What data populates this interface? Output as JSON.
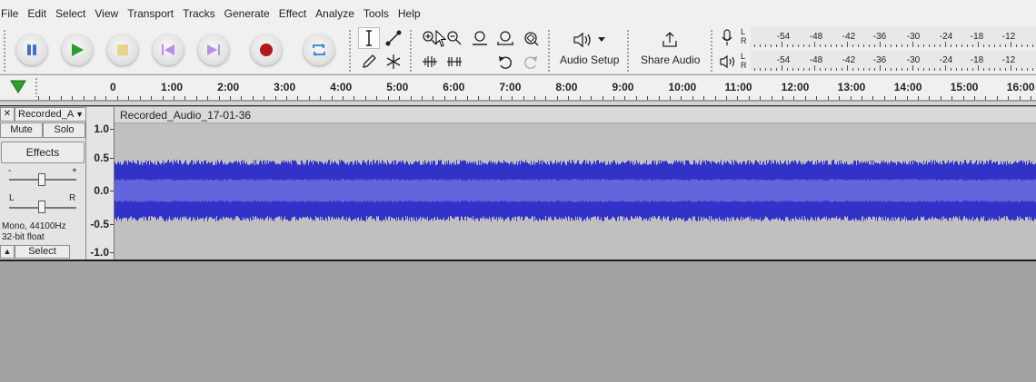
{
  "menu": [
    "File",
    "Edit",
    "Select",
    "View",
    "Transport",
    "Tracks",
    "Generate",
    "Effect",
    "Analyze",
    "Tools",
    "Help"
  ],
  "toolbar": {
    "audio_setup_label": "Audio Setup",
    "share_audio_label": "Share Audio",
    "meter_ticks": [
      "-54",
      "-48",
      "-42",
      "-36",
      "-30",
      "-24",
      "-18",
      "-12"
    ],
    "record_meter_channels": [
      "L",
      "R"
    ],
    "playback_meter_channels": [
      "L",
      "R"
    ]
  },
  "timeline": {
    "labels": [
      "0",
      "1:00",
      "2:00",
      "3:00",
      "4:00",
      "5:00",
      "6:00",
      "7:00",
      "8:00",
      "9:00",
      "10:00",
      "11:00",
      "12:00",
      "13:00",
      "14:00",
      "15:00",
      "16:00"
    ]
  },
  "track": {
    "name": "Recorded_A",
    "clip_name": "Recorded_Audio_17-01-36",
    "mute_label": "Mute",
    "solo_label": "Solo",
    "effects_label": "Effects",
    "gain_minus": "-",
    "gain_plus": "+",
    "pan_left": "L",
    "pan_right": "R",
    "info_line1": "Mono, 44100Hz",
    "info_line2": "32-bit float",
    "select_label": "Select",
    "close_glyph": "✕",
    "dropdown_glyph": "▼",
    "collapse_glyph": "▲",
    "scale_labels": [
      "1.0",
      "0.5",
      "0.0",
      "-0.5",
      "-1.0"
    ]
  },
  "colors": {
    "waveform": "#3232c8",
    "waveform_rms": "#6464dc",
    "clip_background": "#c0c0c0",
    "record_red": "#b4161b",
    "play_green": "#2f9a2f",
    "pause_blue": "#3f6fd8",
    "stop_yellow": "#e8d48a",
    "skip_purple": "#b98ee6",
    "loop_blue": "#3c8fe0"
  }
}
